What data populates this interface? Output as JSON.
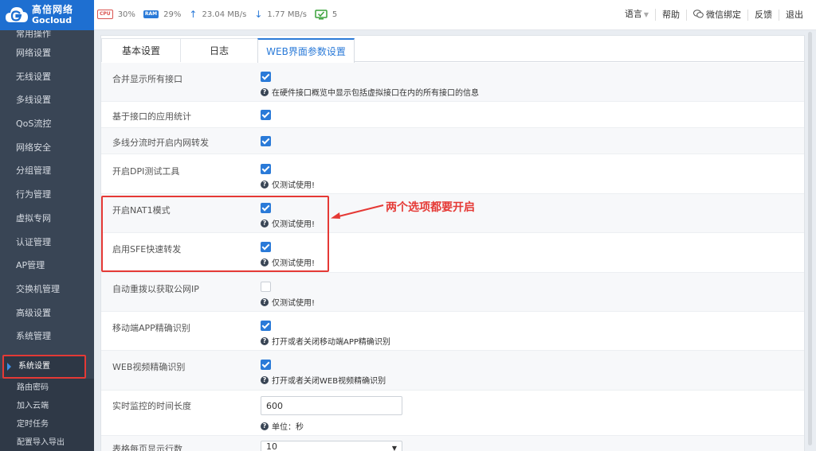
{
  "header": {
    "brand_cn": "高倍网络",
    "brand_en": "Gocloud",
    "cpu_badge": "CPU",
    "cpu": "30%",
    "ram_badge": "RAM",
    "ram": "29%",
    "upload": "23.04 MB/s",
    "download": "1.77 MB/s",
    "devices": "5",
    "menu": {
      "language": "语言",
      "help": "帮助",
      "wechat": "微信绑定",
      "feedback": "反馈",
      "logout": "退出"
    }
  },
  "sidebar": {
    "items": [
      "常用操作",
      "网络设置",
      "无线设置",
      "多线设置",
      "QoS流控",
      "网络安全",
      "分组管理",
      "行为管理",
      "虚拟专网",
      "认证管理",
      "AP管理",
      "交换机管理",
      "高级设置",
      "系统管理"
    ],
    "selected": "系统设置",
    "sub_items": [
      "路由密码",
      "加入云端",
      "定时任务",
      "配置导入导出"
    ]
  },
  "tabs": [
    "基本设置",
    "日志",
    "WEB界面参数设置"
  ],
  "settings": [
    {
      "label": "合并显示所有接口",
      "checked": true,
      "hint": "在硬件接口概览中显示包括虚拟接口在内的所有接口的信息"
    },
    {
      "label": "基于接口的应用统计",
      "checked": true,
      "hint": ""
    },
    {
      "label": "多线分流时开启内网转发",
      "checked": true,
      "hint": ""
    },
    {
      "label": "开启DPI测试工具",
      "checked": true,
      "hint": "仅测试使用!"
    },
    {
      "label": "开启NAT1模式",
      "checked": true,
      "hint": "仅测试使用!"
    },
    {
      "label": "启用SFE快速转发",
      "checked": true,
      "hint": "仅测试使用!"
    },
    {
      "label": "自动重拨以获取公网IP",
      "checked": false,
      "hint": "仅测试使用!"
    },
    {
      "label": "移动端APP精确识别",
      "checked": true,
      "hint": "打开或者关闭移动端APP精确识别"
    },
    {
      "label": "WEB视频精确识别",
      "checked": true,
      "hint": "打开或者关闭WEB视频精确识别"
    },
    {
      "label": "实时监控的时间长度",
      "value": "600",
      "hint": "单位：秒"
    },
    {
      "label": "表格每页显示行数",
      "value": "10"
    }
  ],
  "annotation": "两个选项都要开启",
  "colors": {
    "accent": "#2a7ad8",
    "sidebar": "#394555",
    "highlight": "#e53935",
    "brand": "#1e6fd1"
  }
}
